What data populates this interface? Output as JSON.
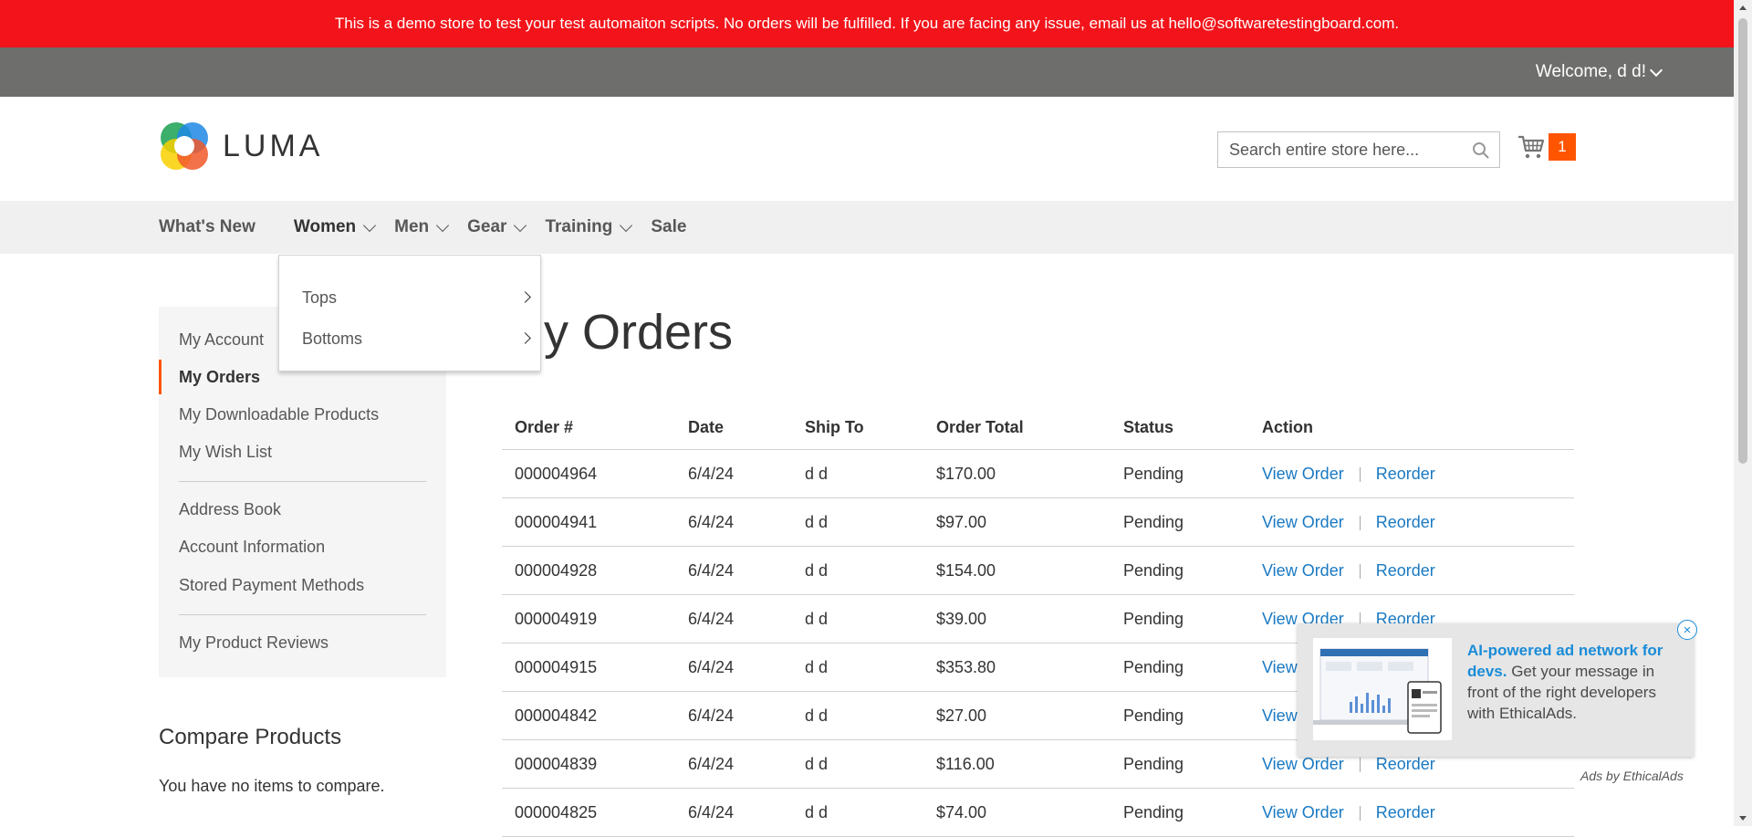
{
  "banner": {
    "text": "This is a demo store to test your test automaiton scripts. No orders will be fulfilled. If you are facing any issue, email us at hello@softwaretestingboard.com."
  },
  "top_bar": {
    "welcome": "Welcome, d d!"
  },
  "header": {
    "logo_text": "LUMA",
    "search_placeholder": "Search entire store here...",
    "cart_count": "1"
  },
  "nav": {
    "items": [
      {
        "label": "What's New",
        "has_submenu": false
      },
      {
        "label": "Women",
        "has_submenu": true,
        "open": true
      },
      {
        "label": "Men",
        "has_submenu": true
      },
      {
        "label": "Gear",
        "has_submenu": true
      },
      {
        "label": "Training",
        "has_submenu": true
      },
      {
        "label": "Sale",
        "has_submenu": false
      }
    ],
    "dropdown": {
      "items": [
        {
          "label": "Tops"
        },
        {
          "label": "Bottoms"
        }
      ]
    }
  },
  "sidebar": {
    "items": [
      {
        "label": "My Account",
        "current": false
      },
      {
        "label": "My Orders",
        "current": true
      },
      {
        "label": "My Downloadable Products",
        "current": false
      },
      {
        "label": "My Wish List",
        "current": false
      },
      {
        "label": "Address Book",
        "current": false
      },
      {
        "label": "Account Information",
        "current": false
      },
      {
        "label": "Stored Payment Methods",
        "current": false
      },
      {
        "label": "My Product Reviews",
        "current": false
      }
    ]
  },
  "compare": {
    "title": "Compare Products",
    "empty_text": "You have no items to compare."
  },
  "main": {
    "page_title": "My Orders",
    "table": {
      "headers": [
        "Order #",
        "Date",
        "Ship To",
        "Order Total",
        "Status",
        "Action"
      ],
      "view_label": "View Order",
      "reorder_label": "Reorder",
      "rows": [
        {
          "order": "000004964",
          "date": "6/4/24",
          "ship_to": "d d",
          "total": "$170.00",
          "status": "Pending"
        },
        {
          "order": "000004941",
          "date": "6/4/24",
          "ship_to": "d d",
          "total": "$97.00",
          "status": "Pending"
        },
        {
          "order": "000004928",
          "date": "6/4/24",
          "ship_to": "d d",
          "total": "$154.00",
          "status": "Pending"
        },
        {
          "order": "000004919",
          "date": "6/4/24",
          "ship_to": "d d",
          "total": "$39.00",
          "status": "Pending"
        },
        {
          "order": "000004915",
          "date": "6/4/24",
          "ship_to": "d d",
          "total": "$353.80",
          "status": "Pending"
        },
        {
          "order": "000004842",
          "date": "6/4/24",
          "ship_to": "d d",
          "total": "$27.00",
          "status": "Pending"
        },
        {
          "order": "000004839",
          "date": "6/4/24",
          "ship_to": "d d",
          "total": "$116.00",
          "status": "Pending"
        },
        {
          "order": "000004825",
          "date": "6/4/24",
          "ship_to": "d d",
          "total": "$74.00",
          "status": "Pending"
        }
      ]
    }
  },
  "ad": {
    "headline": "AI-powered ad network for devs.",
    "body": " Get your message in front of the right developers with EthicalAds.",
    "close": "×",
    "credit": "Ads by EthicalAds"
  },
  "colors": {
    "banner": "#f2141a",
    "top_bar": "#6e6e6d",
    "accent": "#ff5501",
    "link": "#1979c3"
  }
}
